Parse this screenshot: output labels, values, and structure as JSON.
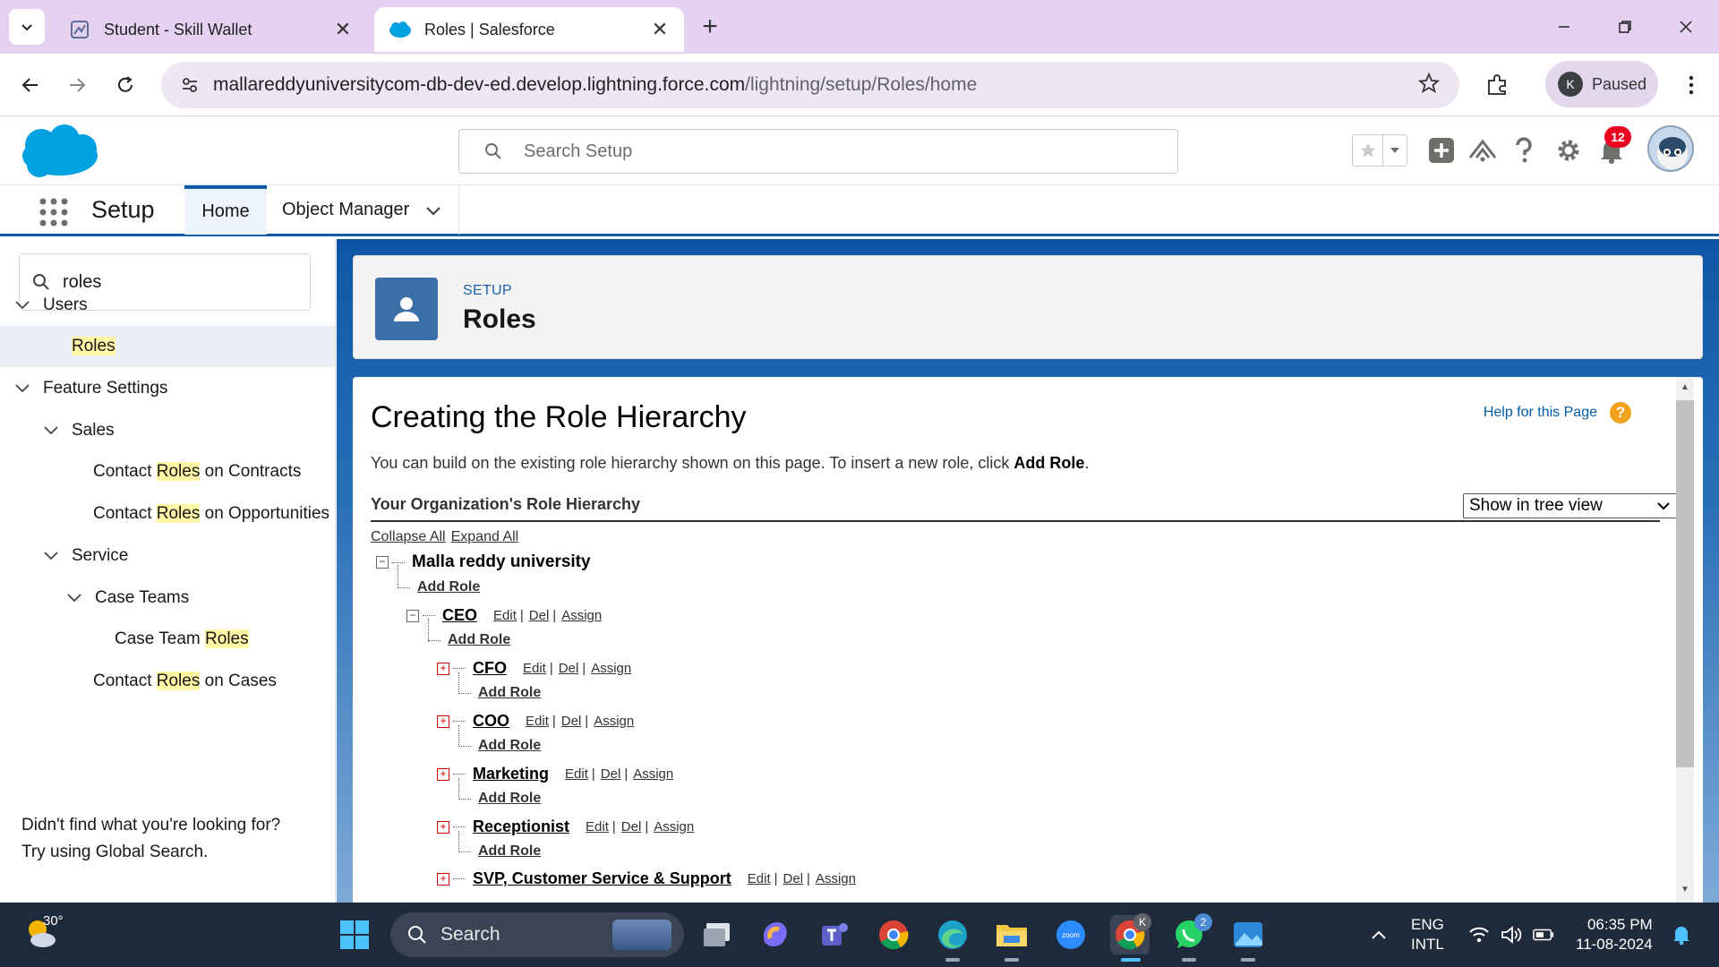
{
  "browser": {
    "tabs": [
      {
        "title": "Student - Skill Wallet",
        "active": false
      },
      {
        "title": "Roles | Salesforce",
        "active": true
      }
    ],
    "url_host": "mallareddyuniversitycom-db-dev-ed.develop.lightning.force.com",
    "url_path": "/lightning/setup/Roles/home",
    "profile_initial": "K",
    "profile_status": "Paused"
  },
  "sf_header": {
    "search_placeholder": "Search Setup",
    "notification_count": "12"
  },
  "sf_nav": {
    "app_name": "Setup",
    "tabs": [
      {
        "label": "Home"
      },
      {
        "label": "Object Manager"
      }
    ]
  },
  "sidebar": {
    "quick_find_value": "roles",
    "tree": [
      {
        "label": "Users",
        "level": 0,
        "expandable": true
      },
      {
        "pre": "",
        "hl": "Roles",
        "post": "",
        "level": 2,
        "selected": true
      },
      {
        "label": "Feature Settings",
        "level": 0,
        "expandable": true
      },
      {
        "label": "Sales",
        "level": 1,
        "expandable": true
      },
      {
        "pre": "Contact ",
        "hl": "Roles",
        "post": " on Contracts",
        "level": 2
      },
      {
        "pre": "Contact ",
        "hl": "Roles",
        "post": " on Opportunities",
        "level": 2
      },
      {
        "label": "Service",
        "level": 1,
        "expandable": true
      },
      {
        "label": "Case Teams",
        "level": 2,
        "expandable": true
      },
      {
        "pre": "Case Team ",
        "hl": "Roles",
        "post": "",
        "level": 3
      },
      {
        "pre": "Contact ",
        "hl": "Roles",
        "post": " on Cases",
        "level": 2
      }
    ],
    "help_line1": "Didn't find what you're looking for?",
    "help_line2": "Try using Global Search."
  },
  "page_header": {
    "eyebrow": "SETUP",
    "title": "Roles"
  },
  "content": {
    "title": "Creating the Role Hierarchy",
    "help_link": "Help for this Page",
    "intro_text": "You can build on the existing role hierarchy shown on this page. To insert a new role, click ",
    "intro_bold": "Add Role",
    "intro_end": ".",
    "hierarchy_heading": "Your Organization's Role Hierarchy",
    "view_select": "Show in tree view",
    "collapse_all": "Collapse All",
    "expand_all": "Expand All",
    "org_name": "Malla reddy university",
    "add_role": "Add Role",
    "edit": "Edit",
    "del": "Del",
    "assign": "Assign",
    "roles": [
      {
        "name": "CEO"
      },
      {
        "name": "CFO"
      },
      {
        "name": "COO"
      },
      {
        "name": "Marketing"
      },
      {
        "name": "Receptionist"
      },
      {
        "name": "SVP, Customer Service & Support"
      }
    ]
  },
  "taskbar": {
    "temperature": "30°",
    "search_label": "Search",
    "teams_badge": "",
    "whatsapp_badge": "2",
    "chrome_badge": "K",
    "lang_line1": "ENG",
    "lang_line2": "INTL",
    "time": "06:35 PM",
    "date": "11-08-2024"
  }
}
